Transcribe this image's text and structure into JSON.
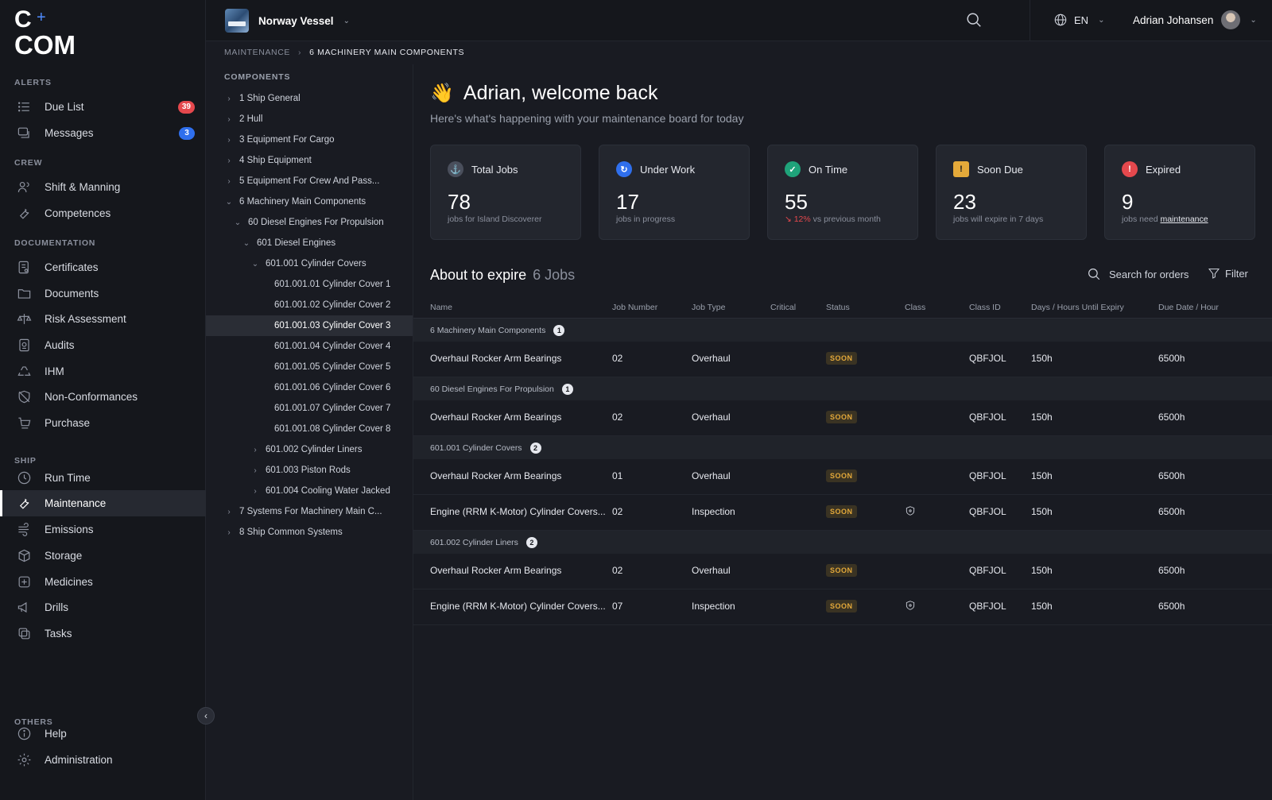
{
  "logo": {
    "line1": "C",
    "line2": "COM"
  },
  "sidebar": {
    "sections": {
      "alerts": "ALERTS",
      "crew": "CREW",
      "documentation": "DOCUMENTATION",
      "ship": "SHIP",
      "others": "OTHERS"
    },
    "items": [
      {
        "label": "Due List",
        "icon": "list-icon",
        "badge": "39",
        "badge_color": "#e5484d"
      },
      {
        "label": "Messages",
        "icon": "message-icon",
        "badge": "3",
        "badge_color": "#2f6fed"
      },
      {
        "label": "Shift & Manning",
        "icon": "users-icon"
      },
      {
        "label": "Competences",
        "icon": "wrench-icon"
      },
      {
        "label": "Certificates",
        "icon": "certificate-icon"
      },
      {
        "label": "Documents",
        "icon": "folder-icon"
      },
      {
        "label": "Risk Assessment",
        "icon": "scale-icon"
      },
      {
        "label": "Audits",
        "icon": "audit-icon"
      },
      {
        "label": "IHM",
        "icon": "recycle-icon"
      },
      {
        "label": "Non-Conformances",
        "icon": "shield-off-icon"
      },
      {
        "label": "Purchase",
        "icon": "cart-icon"
      },
      {
        "label": "Run Time",
        "icon": "clock-icon"
      },
      {
        "label": "Maintenance",
        "icon": "wrench-icon",
        "active": true
      },
      {
        "label": "Emissions",
        "icon": "wind-icon"
      },
      {
        "label": "Storage",
        "icon": "box-icon"
      },
      {
        "label": "Medicines",
        "icon": "medical-icon"
      },
      {
        "label": "Drills",
        "icon": "megaphone-icon"
      },
      {
        "label": "Tasks",
        "icon": "tasks-icon"
      },
      {
        "label": "Help",
        "icon": "info-icon"
      },
      {
        "label": "Administration",
        "icon": "gear-icon"
      }
    ]
  },
  "topbar": {
    "vessel_name": "Norway Vessel",
    "language": "EN",
    "user_name": "Adrian Johansen"
  },
  "breadcrumb": {
    "parent": "MAINTENANCE",
    "current": "6 MACHINERY MAIN COMPONENTS"
  },
  "tree": {
    "title": "COMPONENTS",
    "items": [
      {
        "label": "1 Ship General",
        "caret": "›"
      },
      {
        "label": "2 Hull",
        "caret": "›"
      },
      {
        "label": "3 Equipment For Cargo",
        "caret": "›"
      },
      {
        "label": "4 Ship Equipment",
        "caret": "›"
      },
      {
        "label": "5 Equipment For Crew And Pass...",
        "caret": "›"
      },
      {
        "label": "6 Machinery Main Components",
        "caret": "⌄"
      },
      {
        "label": "60 Diesel Engines For Propulsion",
        "caret": "⌄"
      },
      {
        "label": "601 Diesel Engines",
        "caret": "⌄"
      },
      {
        "label": "601.001 Cylinder Covers",
        "caret": "⌄"
      },
      {
        "label": "601.001.01 Cylinder Cover 1",
        "caret": ""
      },
      {
        "label": "601.001.02 Cylinder Cover 2",
        "caret": ""
      },
      {
        "label": "601.001.03 Cylinder Cover 3",
        "caret": "",
        "selected": true
      },
      {
        "label": "601.001.04 Cylinder Cover 4",
        "caret": ""
      },
      {
        "label": "601.001.05 Cylinder Cover 5",
        "caret": ""
      },
      {
        "label": "601.001.06 Cylinder Cover 6",
        "caret": ""
      },
      {
        "label": "601.001.07 Cylinder Cover 7",
        "caret": ""
      },
      {
        "label": "601.001.08 Cylinder Cover 8",
        "caret": ""
      },
      {
        "label": "601.002 Cylinder Liners",
        "caret": "›"
      },
      {
        "label": "601.003 Piston Rods",
        "caret": "›"
      },
      {
        "label": "601.004 Cooling Water Jacked",
        "caret": "›"
      },
      {
        "label": "7 Systems For Machinery Main C...",
        "caret": "›"
      },
      {
        "label": "8 Ship Common Systems",
        "caret": "›"
      }
    ]
  },
  "welcome": {
    "wave": "👋",
    "title": "Adrian, welcome back",
    "subtitle": "Here's what's happening with your maintenance board for today"
  },
  "cards": [
    {
      "title": "Total Jobs",
      "value": "78",
      "desc": "jobs for Island Discoverer",
      "icon": "anchor-icon",
      "icon_color": "#4a4f5c",
      "glyph": "⚓"
    },
    {
      "title": "Under Work",
      "value": "17",
      "desc": "jobs in progress",
      "icon": "refresh-icon",
      "icon_color": "#2f6fed",
      "glyph": "↻"
    },
    {
      "title": "On Time",
      "value": "55",
      "trend": "↘ 12%",
      "desc": " vs previous month",
      "icon": "check-icon",
      "icon_color": "#1fa37a",
      "glyph": "✓"
    },
    {
      "title": "Soon Due",
      "value": "23",
      "desc": "jobs will expire in 7 days",
      "icon": "warning-icon",
      "icon_color": "#e4a93a",
      "glyph": "!"
    },
    {
      "title": "Expired",
      "value": "9",
      "desc": "jobs need ",
      "link": "maintenance",
      "icon": "alert-icon",
      "icon_color": "#e5484d",
      "glyph": "!"
    }
  ],
  "expire": {
    "title": "About to expire",
    "count": "6 Jobs",
    "search_label": "Search for orders",
    "filter_label": "Filter"
  },
  "table": {
    "columns": [
      "Name",
      "Job Number",
      "Job Type",
      "Critical",
      "Status",
      "Class",
      "Class ID",
      "Days / Hours Until Expiry",
      "Due Date / Hour"
    ],
    "groups": [
      {
        "label": "6 Machinery Main Components",
        "count": "1",
        "rows": [
          {
            "name": "Overhaul Rocker Arm Bearings",
            "job_number": "02",
            "job_type": "Overhaul",
            "critical": "",
            "status": "SOON",
            "class": false,
            "class_id": "QBFJOL",
            "expiry": "150h",
            "due": "6500h"
          }
        ]
      },
      {
        "label": "60 Diesel Engines For Propulsion",
        "count": "1",
        "rows": [
          {
            "name": "Overhaul Rocker Arm Bearings",
            "job_number": "02",
            "job_type": "Overhaul",
            "critical": "",
            "status": "SOON",
            "class": false,
            "class_id": "QBFJOL",
            "expiry": "150h",
            "due": "6500h"
          }
        ]
      },
      {
        "label": "601.001 Cylinder Covers",
        "count": "2",
        "rows": [
          {
            "name": "Overhaul Rocker Arm Bearings",
            "job_number": "01",
            "job_type": "Overhaul",
            "critical": "",
            "status": "SOON",
            "class": false,
            "class_id": "QBFJOL",
            "expiry": "150h",
            "due": "6500h"
          },
          {
            "name": "Engine (RRM K-Motor) Cylinder Covers...",
            "job_number": "02",
            "job_type": "Inspection",
            "critical": "",
            "status": "SOON",
            "class": true,
            "class_id": "QBFJOL",
            "expiry": "150h",
            "due": "6500h"
          }
        ]
      },
      {
        "label": "601.002 Cylinder Liners",
        "count": "2",
        "rows": [
          {
            "name": "Overhaul Rocker Arm Bearings",
            "job_number": "02",
            "job_type": "Overhaul",
            "critical": "",
            "status": "SOON",
            "class": false,
            "class_id": "QBFJOL",
            "expiry": "150h",
            "due": "6500h"
          },
          {
            "name": "Engine (RRM K-Motor) Cylinder Covers...",
            "job_number": "07",
            "job_type": "Inspection",
            "critical": "",
            "status": "SOON",
            "class": true,
            "class_id": "QBFJOL",
            "expiry": "150h",
            "due": "6500h"
          }
        ]
      }
    ]
  }
}
